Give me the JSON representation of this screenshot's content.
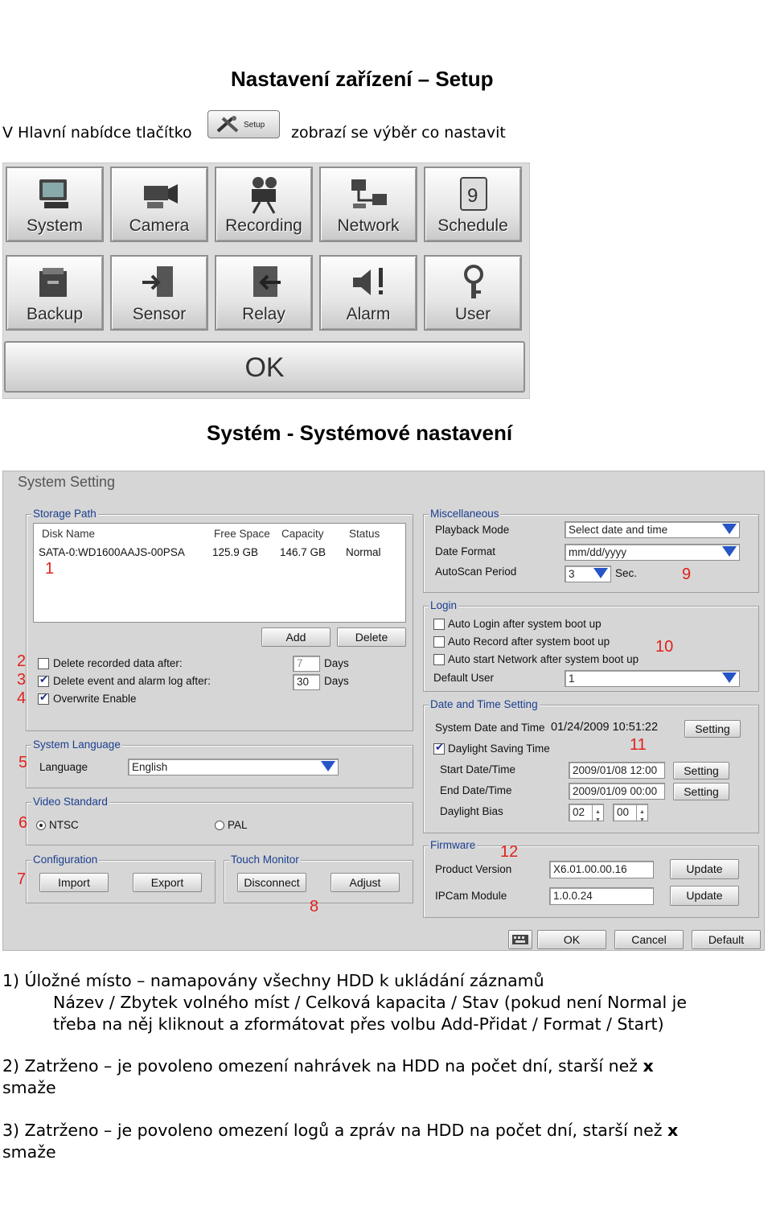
{
  "doc": {
    "title": "Nastavení zařízení – Setup",
    "intro_before": "V Hlavní nabídce tlačítko",
    "intro_after": "zobrazí se výběr co nastavit",
    "setup_button": "Setup",
    "section_title": "Systém - Systémové nastavení",
    "para1_line1": "1) Úložné místo – namapovány všechny HDD k ukládání záznamů",
    "para1_line2": "Název / Zbytek volného míst / Celková kapacita / Stav (pokud není Normal je",
    "para1_line3": "třeba na něj kliknout a zformátovat přes volbu Add-Přidat / Format / Start)",
    "para2_line1_a": "2) Zatrženo – je povoleno omezení nahrávek na HDD na počet dní, starší než ",
    "para2_bold": "x",
    "para2_line2": "smaže",
    "para3_line1_a": "3) Zatrženo – je povoleno omezení logů a zpráv na HDD na počet dní, starší než ",
    "para3_bold": "x",
    "para3_line2": "smaže"
  },
  "menu": {
    "tiles": [
      "System",
      "Camera",
      "Recording",
      "Network",
      "Schedule",
      "Backup",
      "Sensor",
      "Relay",
      "Alarm",
      "User"
    ],
    "ok": "OK"
  },
  "system_setting": {
    "title": "System Setting",
    "storage": {
      "legend": "Storage Path",
      "columns": [
        "Disk Name",
        "Free Space",
        "Capacity",
        "Status"
      ],
      "row": [
        "SATA-0:WD1600AAJS-00PSA",
        "125.9 GB",
        "146.7 GB",
        "Normal"
      ],
      "add": "Add",
      "delete": "Delete",
      "delete_recorded": "Delete recorded data after:",
      "delete_recorded_days": "7",
      "delete_event": "Delete event and alarm log after:",
      "delete_event_days": "30",
      "days": "Days",
      "overwrite": "Overwrite Enable"
    },
    "language": {
      "legend": "System Language",
      "label": "Language",
      "value": "English"
    },
    "video": {
      "legend": "Video Standard",
      "ntsc": "NTSC",
      "pal": "PAL"
    },
    "config": {
      "legend": "Configuration",
      "import": "Import",
      "export": "Export"
    },
    "touch": {
      "legend": "Touch Monitor",
      "disconnect": "Disconnect",
      "adjust": "Adjust"
    },
    "misc": {
      "legend": "Miscellaneous",
      "playback_label": "Playback Mode",
      "playback_value": "Select date and time",
      "date_format_label": "Date Format",
      "date_format_value": "mm/dd/yyyy",
      "autoscan_label": "AutoScan Period",
      "autoscan_value": "3",
      "sec": "Sec."
    },
    "login": {
      "legend": "Login",
      "auto_login": "Auto Login after system boot up",
      "auto_record": "Auto Record after system boot up",
      "auto_network": "Auto start Network after system boot up",
      "default_user_label": "Default User",
      "default_user_value": "1"
    },
    "datetime": {
      "legend": "Date and Time Setting",
      "system_label": "System Date and Time",
      "system_value": "01/24/2009  10:51:22",
      "setting": "Setting",
      "dst": "Daylight Saving Time",
      "start_label": "Start Date/Time",
      "start_value": "2009/01/08  12:00",
      "end_label": "End Date/Time",
      "end_value": "2009/01/09  00:00",
      "bias_label": "Daylight Bias",
      "bias_h": "02",
      "bias_m": "00"
    },
    "firmware": {
      "legend": "Firmware",
      "product_label": "Product Version",
      "product_value": "X6.01.00.00.16",
      "ipcam_label": "IPCam Module",
      "ipcam_value": "1.0.0.24",
      "update": "Update"
    },
    "footer": {
      "ok": "OK",
      "cancel": "Cancel",
      "default": "Default"
    },
    "markers": [
      "1",
      "2",
      "3",
      "4",
      "5",
      "6",
      "7",
      "8",
      "9",
      "10",
      "11",
      "12"
    ]
  },
  "colors": {
    "legend_blue": "#1b3f8f",
    "marker_red": "#e0211b",
    "dropdown_blue": "#2755c7"
  }
}
